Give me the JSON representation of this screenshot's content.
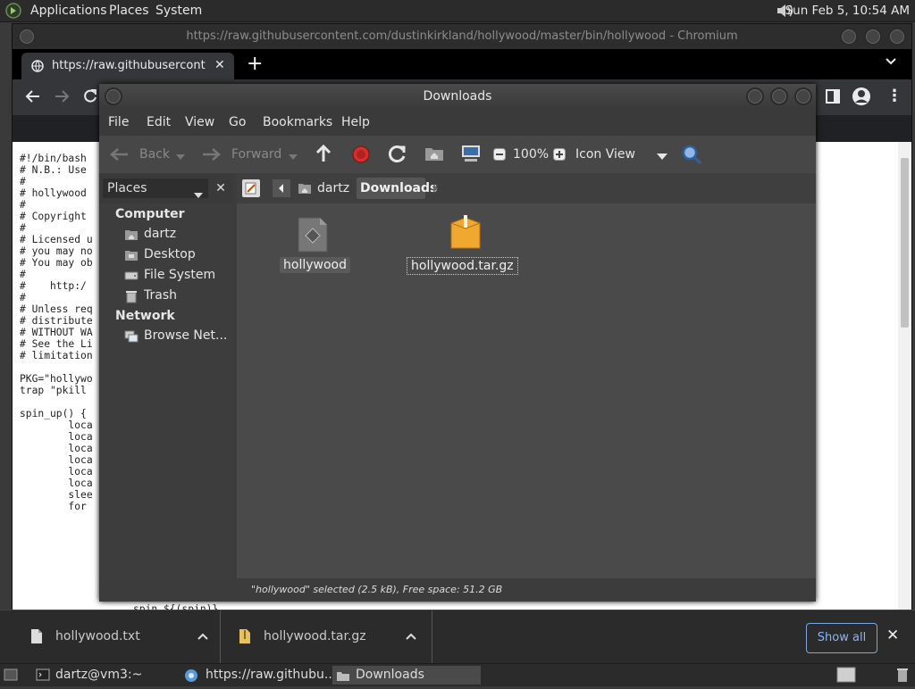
{
  "top_panel": {
    "menus": [
      "Applications",
      "Places",
      "System"
    ],
    "clock": "Sun Feb  5, 10:54 AM"
  },
  "chromium": {
    "window_title": "https://raw.githubusercontent.com/dustinkirkland/hollywood/master/bin/hollywood - Chromium",
    "tab_title": "https://raw.githubusercontent.com/dustinkirkland/hollywood/master/bin/hollywood",
    "page_lines": [
      "#!/bin/bash",
      "# N.B.: Use",
      "#",
      "# hollywood",
      "#",
      "# Copyright",
      "#",
      "# Licensed u",
      "# you may no",
      "# You may ob",
      "#",
      "#    http:/",
      "#",
      "# Unless req",
      "# distribute",
      "# WITHOUT WA",
      "# See the Li",
      "# limitation",
      "",
      "PKG=\"hollywo",
      "trap \"pkill ",
      "",
      "spin_up() {",
      "        loca",
      "        loca",
      "        loca",
      "        loca",
      "        loca",
      "        loca",
      "        slee",
      "        for "
    ],
    "hidden_line_1": "spin ${(spin)}"
  },
  "downloads_shelf": {
    "items": [
      {
        "name": "hollywood.txt"
      },
      {
        "name": "hollywood.tar.gz"
      }
    ],
    "show_all": "Show all",
    "close": "✕"
  },
  "bottom_panel": {
    "tasks": [
      "dartz@vm3:~",
      "https://raw.githubu...",
      "Downloads"
    ]
  },
  "nautilus": {
    "title": "Downloads",
    "menu": [
      "File",
      "Edit",
      "View",
      "Go",
      "Bookmarks",
      "Help"
    ],
    "toolbar": {
      "back": "Back",
      "forward": "Forward",
      "zoom": "100%",
      "view_mode": "Icon View"
    },
    "places_combo": "Places",
    "sidebar": {
      "computer_heading": "Computer",
      "computer_items": [
        "dartz",
        "Desktop",
        "File System",
        "Trash"
      ],
      "network_heading": "Network",
      "network_items": [
        "Browse Net..."
      ]
    },
    "path": [
      "dartz",
      "Downloads"
    ],
    "files": [
      {
        "name": "hollywood",
        "type": "script"
      },
      {
        "name": "hollywood.tar.gz",
        "type": "archive"
      }
    ],
    "status": "\"hollywood\" selected (2.5 kB), Free space: 51.2 GB"
  },
  "colors": {
    "chrome_accent": "#8ab4f8",
    "archive_icon": "#f0a830",
    "stop_icon": "#d0312d"
  }
}
